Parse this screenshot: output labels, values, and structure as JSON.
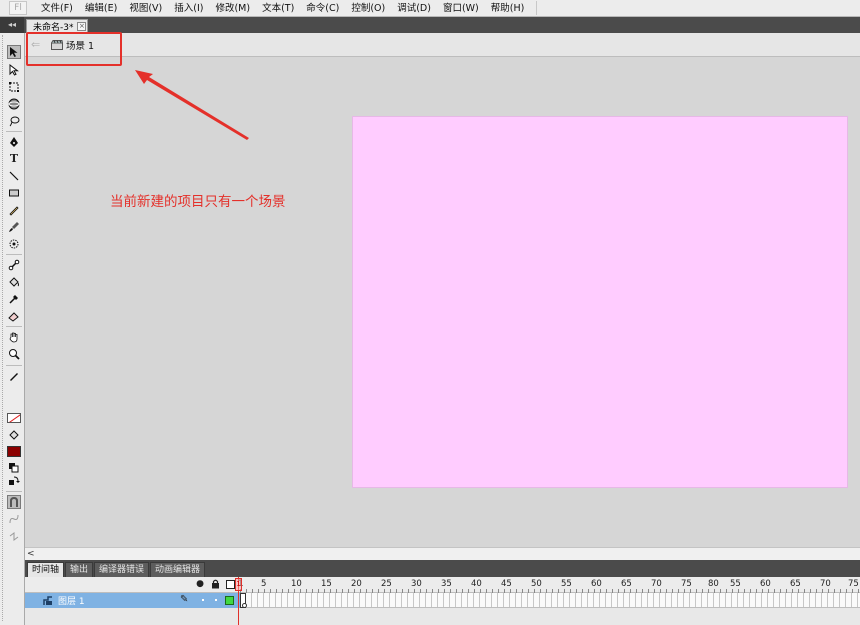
{
  "menu": {
    "items": [
      "文件(F)",
      "编辑(E)",
      "视图(V)",
      "插入(I)",
      "修改(M)",
      "文本(T)",
      "命令(C)",
      "控制(O)",
      "调试(D)",
      "窗口(W)",
      "帮助(H)"
    ]
  },
  "document": {
    "tab_title": "未命名-3*",
    "collapse_glyph": "◂◂"
  },
  "editbar": {
    "scene_label": "场景 1"
  },
  "annotation": {
    "text": "当前新建的项目只有一个场景",
    "color": "#e4302a"
  },
  "stage": {
    "background_color": "#ffccff"
  },
  "panel": {
    "tabs": [
      "时间轴",
      "输出",
      "编译器错误",
      "动画编辑器"
    ]
  },
  "timeline": {
    "frame_numbers": [
      "1",
      "5",
      "10",
      "15",
      "20",
      "25",
      "30",
      "35",
      "40",
      "45",
      "50",
      "55",
      "60",
      "65",
      "70",
      "75",
      "80",
      "55",
      "60",
      "65",
      "70",
      "75"
    ],
    "layer": {
      "name": "图层 1",
      "color": "#41d841"
    }
  },
  "tools": [
    "selection-tool",
    "subselection-tool",
    "free-transform-tool",
    "3d-rotation-tool",
    "lasso-tool",
    "pen-tool",
    "text-tool",
    "line-tool",
    "rectangle-tool",
    "pencil-tool",
    "brush-tool",
    "deco-tool",
    "bone-tool",
    "paint-bucket-tool",
    "eyedropper-tool",
    "eraser-tool",
    "hand-tool",
    "zoom-tool"
  ],
  "colors": {
    "fill": "#8b0000",
    "stroke": "#ffffff"
  }
}
